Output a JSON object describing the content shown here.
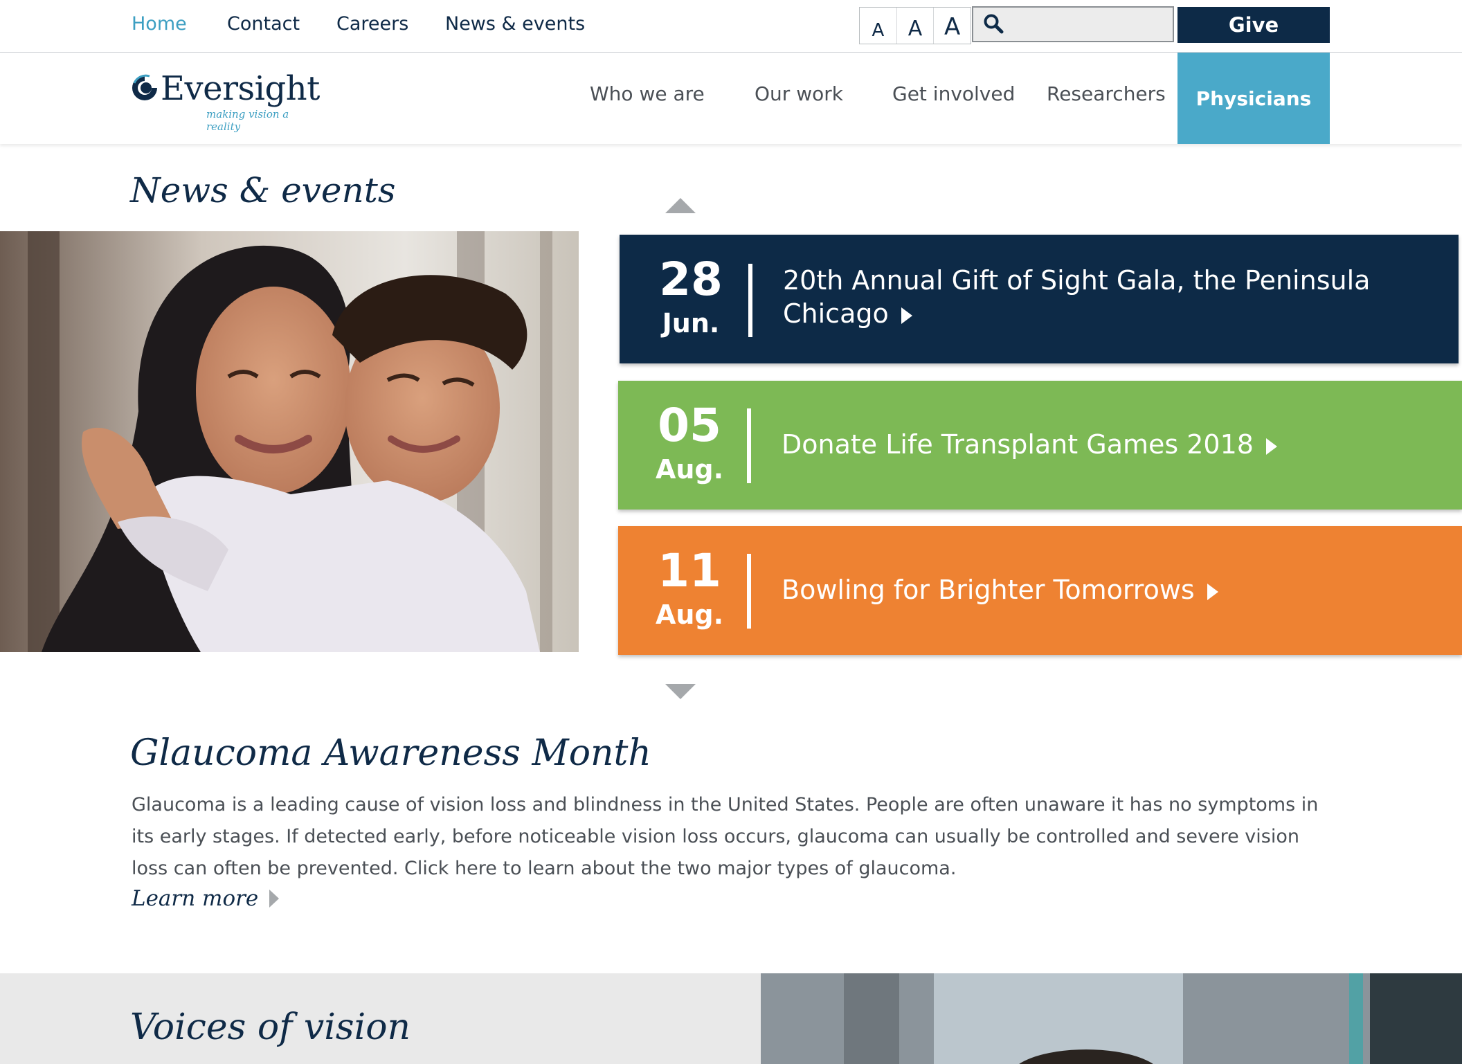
{
  "utility_nav": {
    "links": [
      "Home",
      "Contact",
      "Careers",
      "News & events"
    ],
    "font_size_labels": [
      "A",
      "A",
      "A"
    ],
    "search": {
      "placeholder": ""
    },
    "give_label": "Give"
  },
  "brand": {
    "name": "Eversight",
    "tagline": "making vision a reality"
  },
  "main_nav": {
    "items": [
      "Who we are",
      "Our work",
      "Get involved",
      "Researchers"
    ],
    "highlighted": "Physicians"
  },
  "news": {
    "title": "News & events",
    "events": [
      {
        "day": "28",
        "month": "Jun.",
        "title": "20th Annual Gift of Sight Gala, the Peninsula Chicago",
        "color": "#0d2a47"
      },
      {
        "day": "05",
        "month": "Aug.",
        "title": "Donate Life Transplant Games 2018",
        "color": "#7db955"
      },
      {
        "day": "11",
        "month": "Aug.",
        "title": "Bowling for Brighter Tomorrows",
        "color": "#ee8232"
      }
    ]
  },
  "glaucoma": {
    "title": "Glaucoma Awareness Month",
    "body": "Glaucoma is a leading cause of vision loss and blindness in the United States. People are often unaware it has no symptoms in its early stages. If detected early, before noticeable vision loss occurs, glaucoma can usually be controlled and severe vision loss can often be prevented. Click here to learn about the two major types of glaucoma.",
    "learn_more": "Learn more"
  },
  "voices": {
    "title": "Voices of vision"
  },
  "colors": {
    "navy": "#0d2a47",
    "accent_blue": "#4aa9c9",
    "active_link": "#3d9fc2",
    "green": "#7db955",
    "orange": "#ee8232"
  }
}
